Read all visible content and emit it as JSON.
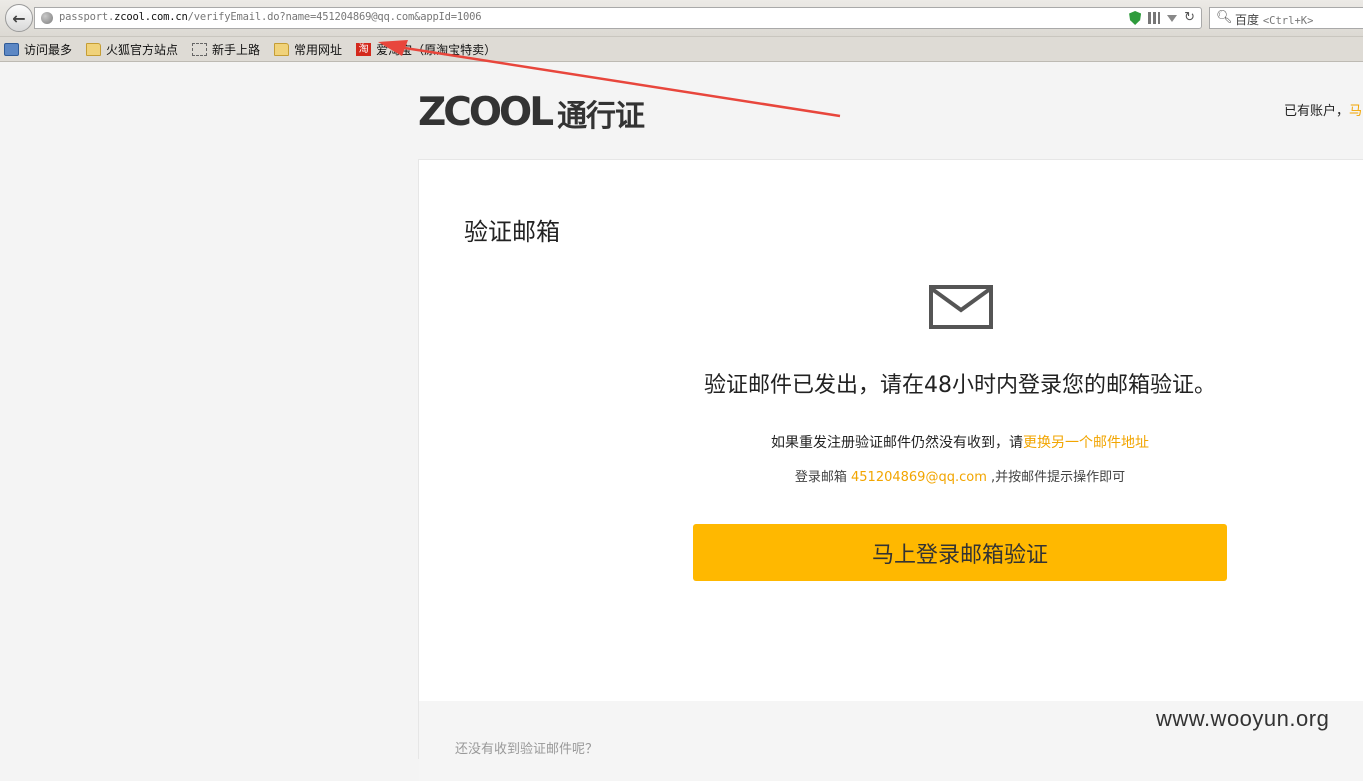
{
  "browser": {
    "url_host_prefix": "passport.",
    "url_host_main": "zcool.com.cn",
    "url_rest": "/verifyEmail.do?name=451204869@qq.com&appId=1006",
    "search_engine": "百度",
    "search_hint": "<Ctrl+K>"
  },
  "bookmarks": [
    {
      "label": "访问最多",
      "icon": "bookmark-star-icon"
    },
    {
      "label": "火狐官方站点",
      "icon": "folder-icon"
    },
    {
      "label": "新手上路",
      "icon": "dotted-box-icon"
    },
    {
      "label": "常用网址",
      "icon": "folder-icon"
    },
    {
      "label": "爱淘宝（原淘宝特卖）",
      "icon": "taobao-icon",
      "icon_text": "淘"
    }
  ],
  "header": {
    "logo_brand": "ZCOOL",
    "logo_suffix": "通行证",
    "account_prefix": "已有账户，",
    "login_link": "马"
  },
  "card": {
    "title": "验证邮箱",
    "sent_message": "验证邮件已发出，请在48小时内登录您的邮箱验证。",
    "resend_prefix": "如果重发注册验证邮件仍然没有收到，请",
    "resend_link": "更换另一个邮件地址",
    "email_prefix": "登录邮箱 ",
    "email_address": "451204869@qq.com",
    "email_suffix": " ,并按邮件提示操作即可",
    "verify_button": "马上登录邮箱验证",
    "footer_text": "还没有收到验证邮件呢？"
  },
  "watermark": "www.wooyun.org",
  "colors": {
    "accent": "#ffb800",
    "link": "#f2a500",
    "annotation_arrow": "#e8463c"
  }
}
